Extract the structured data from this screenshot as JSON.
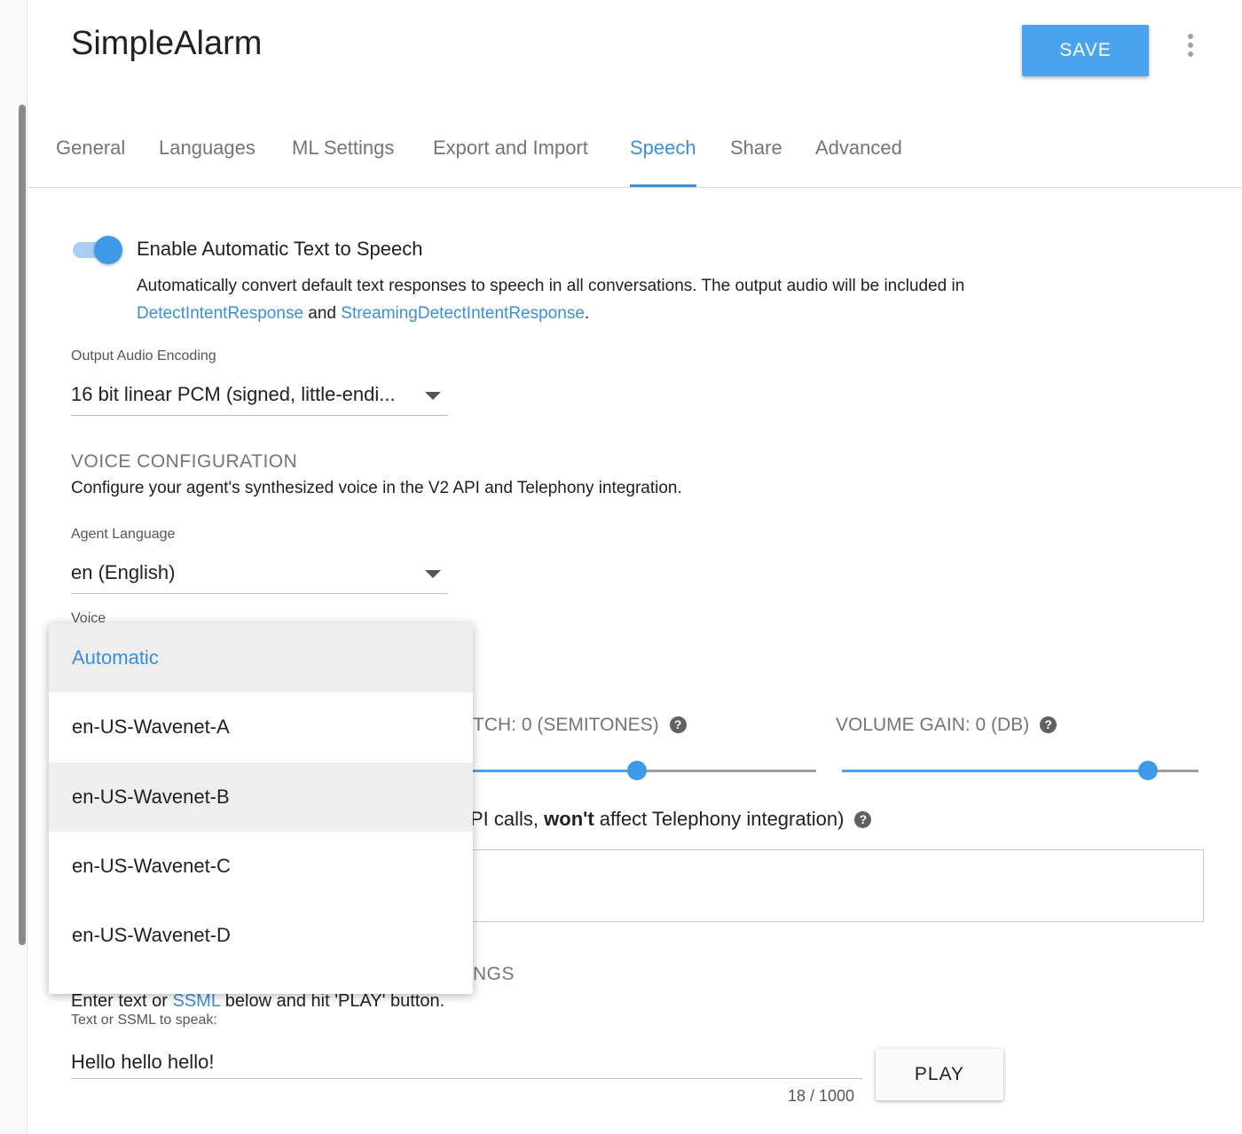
{
  "app": {
    "title": "SimpleAlarm",
    "save_label": "SAVE"
  },
  "tabs": [
    {
      "label": "General"
    },
    {
      "label": "Languages"
    },
    {
      "label": "ML Settings"
    },
    {
      "label": "Export and Import"
    },
    {
      "label": "Speech",
      "active": true
    },
    {
      "label": "Share"
    },
    {
      "label": "Advanced"
    }
  ],
  "speech": {
    "tts_toggle": {
      "label": "Enable Automatic Text to Speech",
      "enabled": true
    },
    "tts_desc": {
      "text_before": "Automatically convert default text responses to speech in all conversations. The output audio will be included in ",
      "link1": "DetectIntentResponse",
      "middle": " and ",
      "link2": "StreamingDetectIntentResponse",
      "end": "."
    },
    "encoding": {
      "label": "Output Audio Encoding",
      "value": "16 bit linear PCM (signed, little-endi..."
    },
    "voice_config": {
      "heading": "VOICE CONFIGURATION",
      "description": "Configure your agent's synthesized voice in the V2 API and Telephony integration."
    },
    "agent_language": {
      "label": "Agent Language",
      "value": "en (English)"
    },
    "voice": {
      "label": "Voice"
    },
    "pitch": {
      "label": "TCH: 0 (SEMITONES)",
      "help": "?",
      "value": 0
    },
    "volume_gain": {
      "label": "VOLUME GAIN: 0 (DB)",
      "help": "?",
      "value": 0
    },
    "profile": {
      "text_part1": "PI calls, ",
      "text_bold": "won't",
      "text_part2": " affect Telephony integration)",
      "help": "?"
    },
    "try_it": {
      "heading_fragment": "NGS",
      "desc_before": "Enter text or ",
      "desc_link": "SSML",
      "desc_after": " below and hit 'PLAY' button.",
      "input_label": "Text or SSML to speak:",
      "input_value": "Hello hello hello!",
      "char_count": "18 / 1000",
      "play_label": "PLAY"
    }
  },
  "voice_menu": {
    "options": [
      "Automatic",
      "en-US-Wavenet-A",
      "en-US-Wavenet-B",
      "en-US-Wavenet-C",
      "en-US-Wavenet-D"
    ],
    "selected": "Automatic",
    "hovered": "en-US-Wavenet-B"
  },
  "colors": {
    "accent": "#3b8fd9",
    "save_button": "#4aa3ec",
    "slider": "#4aa3ec"
  }
}
